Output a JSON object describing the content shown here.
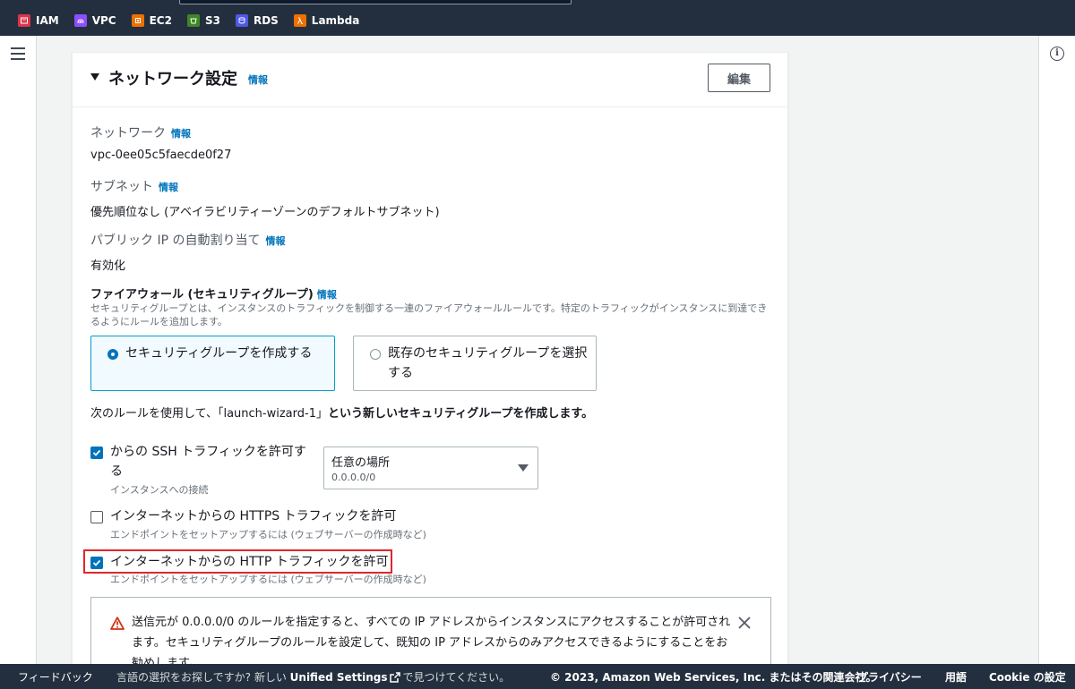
{
  "favorites": [
    {
      "label": "IAM",
      "icon": "iam-icon",
      "color": "#dd344c"
    },
    {
      "label": "VPC",
      "icon": "vpc-icon",
      "color": "#8c4fff"
    },
    {
      "label": "EC2",
      "icon": "ec2-icon",
      "color": "#ed7100"
    },
    {
      "label": "S3",
      "icon": "s3-icon",
      "color": "#3f8624"
    },
    {
      "label": "RDS",
      "icon": "rds-icon",
      "color": "#4f59e8"
    },
    {
      "label": "Lambda",
      "icon": "lambda-icon",
      "color": "#ed7100"
    }
  ],
  "panel": {
    "title": "ネットワーク設定",
    "info": "情報",
    "edit_label": "編集"
  },
  "fields": {
    "network_label": "ネットワーク",
    "network_value": "vpc-0ee05c5faecde0f27",
    "subnet_label": "サブネット",
    "subnet_value": "優先順位なし (アベイラビリティーゾーンのデフォルトサブネット)",
    "public_ip_label": "パブリック IP の自動割り当て",
    "public_ip_value": "有効化"
  },
  "firewall": {
    "label": "ファイアウォール (セキュリティグループ)",
    "description": "セキュリティグループとは、インスタンスのトラフィックを制御する一連のファイアウォールルールです。特定のトラフィックがインスタンスに到達できるようにルールを追加します。",
    "options": [
      {
        "label": "セキュリティグループを作成する",
        "selected": true
      },
      {
        "label": "既存のセキュリティグループを選択する",
        "selected": false
      }
    ],
    "rule_prefix": "次のルールを使用して、「launch-wizard-1」",
    "rule_suffix": "という新しいセキュリティグループを作成します。"
  },
  "rules": {
    "ssh": {
      "label": "からの SSH トラフィックを許可する",
      "desc": "インスタンスへの接続",
      "checked": true
    },
    "source_select": {
      "value": "任意の場所",
      "sub": "0.0.0.0/0"
    },
    "https": {
      "label": "インターネットからの HTTPS トラフィックを許可",
      "desc": "エンドポイントをセットアップするには (ウェブサーバーの作成時など)",
      "checked": false
    },
    "http": {
      "label": "インターネットからの HTTP トラフィックを許可",
      "desc": "エンドポイントをセットアップするには (ウェブサーバーの作成時など)",
      "checked": true
    }
  },
  "alert": {
    "text": "送信元が 0.0.0.0/0 のルールを指定すると、すべての IP アドレスからインスタンスにアクセスすることが許可されます。セキュリティグループのルールを設定して、既知の IP アドレスからのみアクセスできるようにすることをお勧めします。"
  },
  "footer": {
    "feedback": "フィードバック",
    "lang_prefix": "言語の選択をお探しですか? 新しい",
    "lang_link": "Unified Settings",
    "lang_suffix": "で見つけてください。",
    "copyright": "© 2023, Amazon Web Services, Inc. またはその関連会社。",
    "privacy": "プライバシー",
    "terms": "用語",
    "cookie": "Cookie の設定"
  },
  "colors": {
    "accent": "#0073bb",
    "highlight": "#e0262b",
    "warning": "#d13212",
    "nav_bg": "#232f3e"
  }
}
